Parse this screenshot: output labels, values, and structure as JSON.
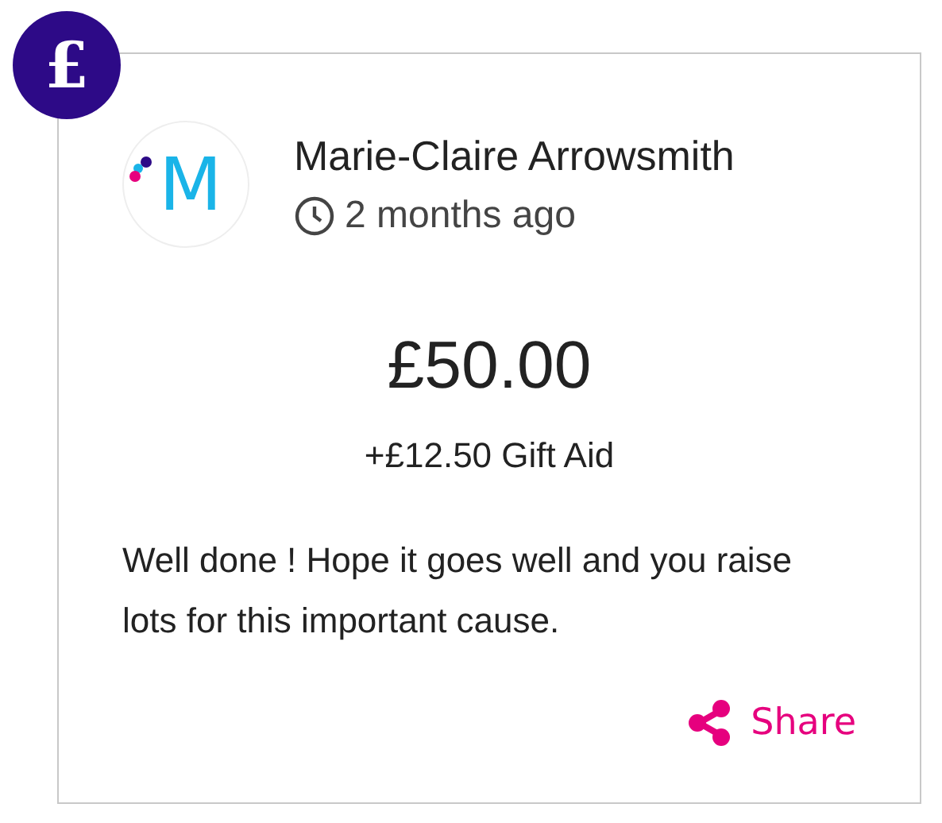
{
  "badge": {
    "symbol": "£"
  },
  "donor": {
    "avatar_letter": "M",
    "name": "Marie-Claire Arrowsmith",
    "time": "2 months ago"
  },
  "amount": "£50.00",
  "gift_aid": "+£12.50 Gift Aid",
  "message": "Well done ! Hope it goes well and you raise lots for this important cause.",
  "share": {
    "label": "Share"
  }
}
